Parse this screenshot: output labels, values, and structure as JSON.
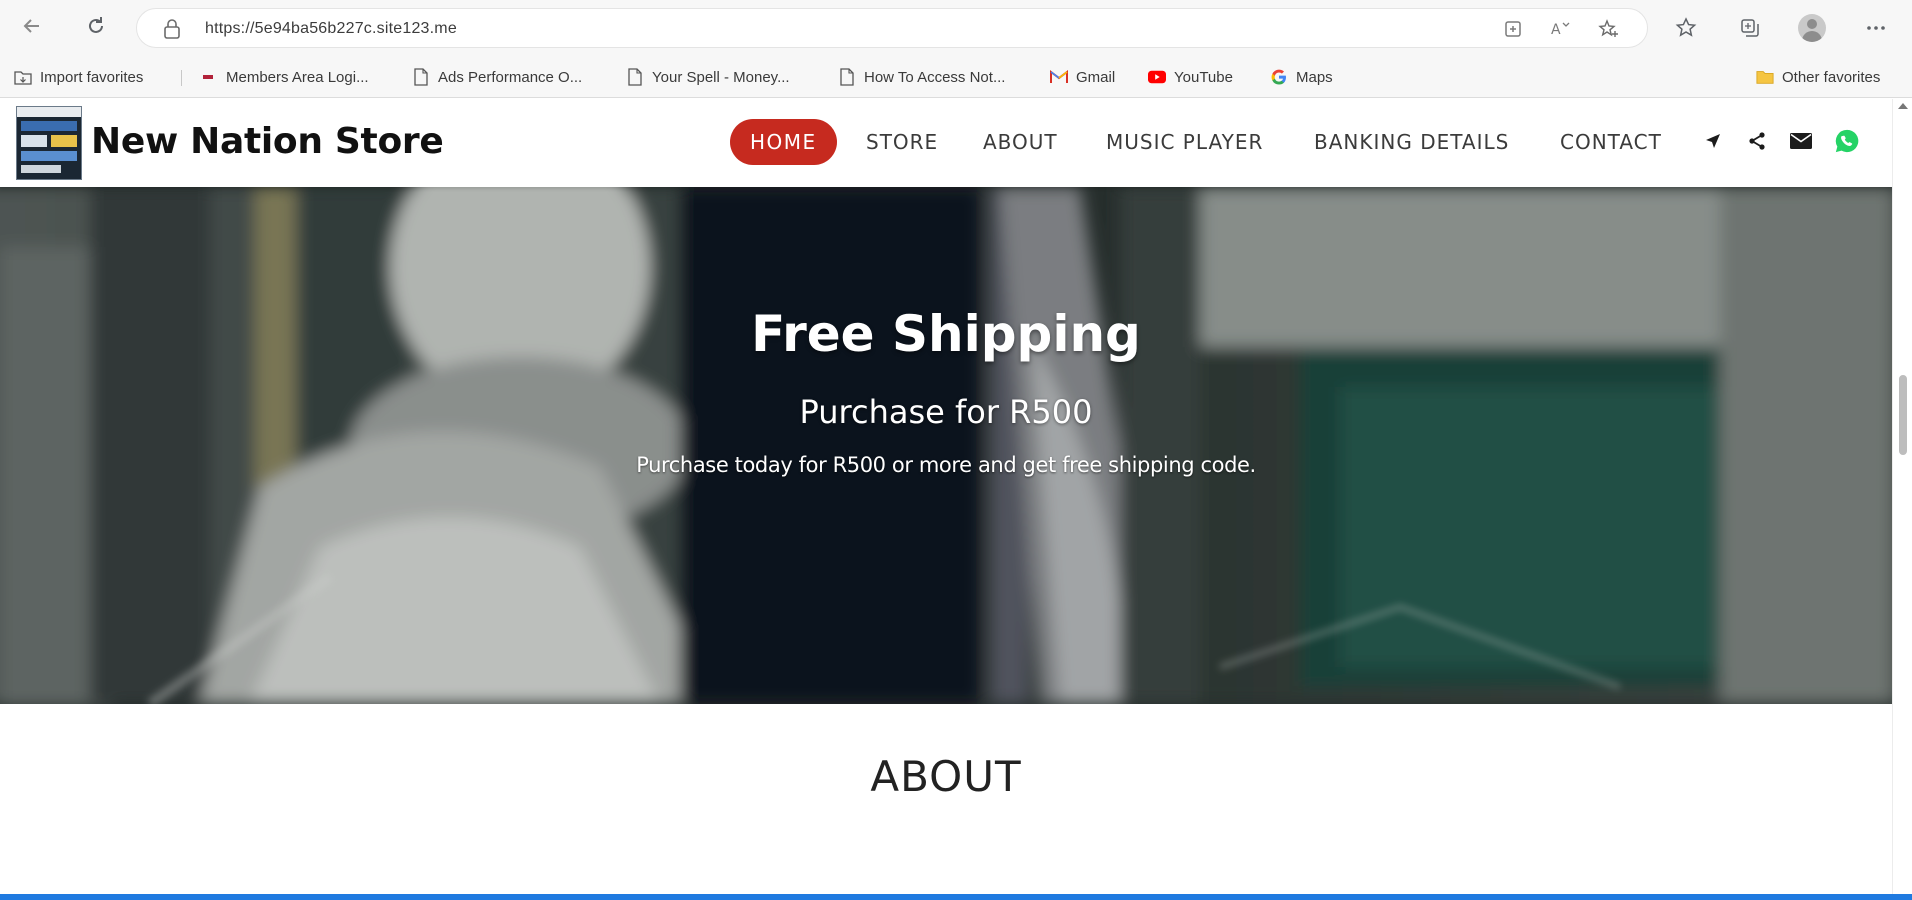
{
  "browser": {
    "url": "https://5e94ba56b227c.site123.me",
    "bookmarks": [
      {
        "label": "Import favorites",
        "icon": "folder-import-icon"
      },
      {
        "label": "Members Area Logi...",
        "icon": "site-icon"
      },
      {
        "label": "Ads Performance O...",
        "icon": "page-icon"
      },
      {
        "label": "Your Spell - Money...",
        "icon": "page-icon"
      },
      {
        "label": "How To Access Not...",
        "icon": "page-icon"
      },
      {
        "label": "Gmail",
        "icon": "gmail-icon"
      },
      {
        "label": "YouTube",
        "icon": "youtube-icon"
      },
      {
        "label": "Maps",
        "icon": "google-icon"
      },
      {
        "label": "Other favorites",
        "icon": "folder-icon"
      }
    ]
  },
  "site": {
    "title": "New Nation Store",
    "nav": [
      "HOME",
      "STORE",
      "ABOUT",
      "MUSIC PLAYER",
      "BANKING DETAILS",
      "CONTACT"
    ],
    "nav_active": "HOME",
    "nav_icons": [
      "location-arrow-icon",
      "share-icon",
      "envelope-icon",
      "whatsapp-icon"
    ],
    "accent_color": "#c62a1f",
    "whatsapp_color": "#25d366"
  },
  "hero": {
    "title": "Free Shipping",
    "subtitle": "Purchase for R500",
    "description": "Purchase today for R500 or more  and get free shipping code."
  },
  "about": {
    "heading": "ABOUT"
  }
}
